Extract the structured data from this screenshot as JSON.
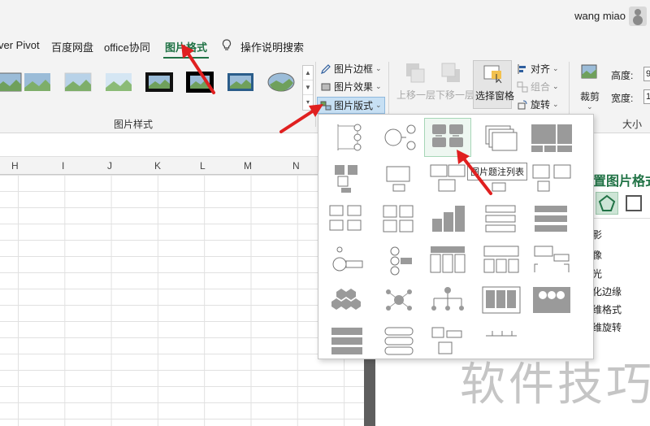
{
  "titlebar": {
    "user_name": "wang miao"
  },
  "tabs": {
    "power_pivot": "ver Pivot",
    "baidu_disk": "百度网盘",
    "office_collab": "office协同",
    "picture_format": "图片格式",
    "tell_me": "操作说明搜索"
  },
  "ribbon": {
    "picture_styles_group": "图片样式",
    "border": "图片边框",
    "effects": "图片效果",
    "layout": "图片版式",
    "bring_forward": "上移一层",
    "send_backward": "下移一层",
    "selection_pane": "选择窗格",
    "align": "对齐",
    "group": "组合",
    "rotate": "旋转",
    "crop": "裁剪",
    "height_label": "高度:",
    "height_value": "9",
    "width_label": "宽度:",
    "width_value": "1",
    "size_group": "大小"
  },
  "columns": [
    "H",
    "I",
    "J",
    "K",
    "L",
    "M",
    "N"
  ],
  "dropdown": {
    "tooltip": "图片题注列表",
    "hovered_layout": "图片题注列表"
  },
  "format_pane": {
    "title": "置图片格式",
    "items": [
      "影",
      "像",
      "光",
      "化边缘",
      "维格式",
      "维旋转"
    ]
  },
  "watermark": "软件技巧",
  "colors": {
    "accent": "#217346",
    "annotation": "#e02020"
  }
}
